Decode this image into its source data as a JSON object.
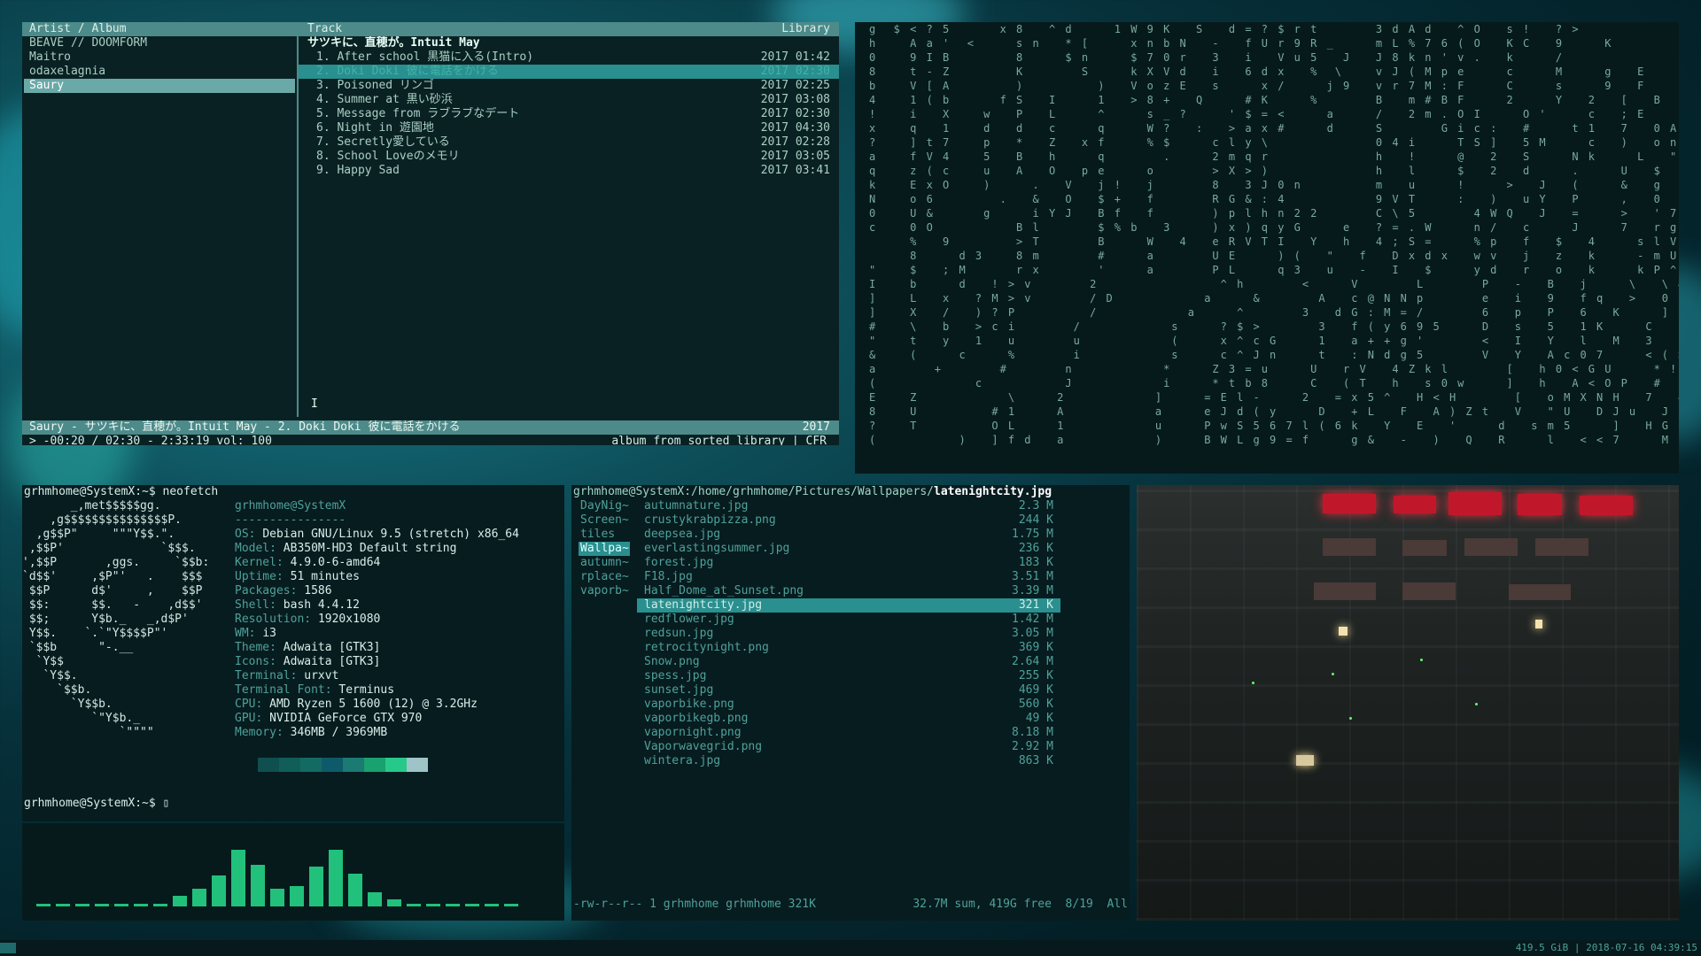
{
  "cmus": {
    "header": {
      "left": "Artist / Album",
      "mid": "Track",
      "right": "Library"
    },
    "artists": [
      "BEAVE // DOOMFORM",
      "Maitro",
      "odaxelagnia",
      "Saury"
    ],
    "selected_artist": "Saury",
    "album_title": "サツキに、直穂が。Intuit May",
    "tracks": [
      {
        "n": "1.",
        "title": "After school 黒猫に入る(Intro)",
        "time": "2017 01:42"
      },
      {
        "n": "2.",
        "title": "Doki Doki 彼に電話をかける",
        "time": "2017 02:30"
      },
      {
        "n": "3.",
        "title": "Poisoned リンゴ",
        "time": "2017 02:25"
      },
      {
        "n": "4.",
        "title": "Summer at 黒い砂浜",
        "time": "2017 03:08"
      },
      {
        "n": "5.",
        "title": "Message from ラブラブなデート",
        "time": "2017 02:30"
      },
      {
        "n": "6.",
        "title": "Night in 遊園地",
        "time": "2017 04:30"
      },
      {
        "n": "7.",
        "title": "Secretly愛している",
        "time": "2017 02:28"
      },
      {
        "n": "8.",
        "title": "School Loveのメモリ",
        "time": "2017 03:05"
      },
      {
        "n": "9.",
        "title": "Happy Sad",
        "time": "2017 03:41"
      }
    ],
    "current_index": 1,
    "status_line": "Saury - サツキに、直穂が。Intuit May -  2. Doki Doki 彼に電話をかける",
    "status_year": "2017",
    "progress_line": "> -00:20 / 02:30 - 2:33:19 vol: 100",
    "progress_mode": "album from sorted library | CFR",
    "cursor_glyph": "I"
  },
  "matrix": {
    "rows": [
      "g  $ < ? 5      x 8   ^ d     1 W 9 K   S   d = ? $ r t       3 d A d   ^ O   s !   ? >             4 Q",
      "h    A a '  <     s n   * [     x n b N   -   f U r 9 R _     m L % 7 6 ( O   K C   9     K           ] |",
      "0    9 I B        8     $ n     $ 7 0 r   3   i   V u 5   J   J 8 k n ' v .   k     /                 Q <",
      "8    t - Z        K       S     k X V d   i   6 d x   %  \\    v J ( M p e     c     M     g   E         =",
      "b    V [ A        )         )   V o z E   s     x /     j 9   v r 7 M : F     C     s     9   F         =",
      "4    1 ( b      f S   I     1   > 8 +   Q     # K     %       B   m # B F     2     Y   2   [   B       \\",
      "!    i   X    w   P   L     ^     s _ ?     ' $ = <     a     /   2 m . O I     O '     c   ; E         !",
      "x    q   1    d   d   c     q     W ?   :   > a x #     d     S       G i c :   #     t 1   7   0 A Z   d",
      "?    ] t 7    p   *   Z   x f     % $     c l y \\             0 4 i     T S ]   5 M     c   )   o n 4   d",
      "a    f V 4    5   B   h     q       .     2 m q r             h   !     @   2   S     N k     L   \"   f 2 x 6 b",
      "q    z ( c    u   A   O   p e     o       > X > )             h   l     $   2   d     .     U   $   9 : 9 1 0 f",
      "k    E x O    )     .   V   j !   j       8   3 J 0 n         m   u     !     >   J   (     &   g   . k l t 2 b",
      "N    o 6        .   &   O   $ +   f       R G & : 4           9 V T     :   )   u Y   P     ,   0   ! 8 S Y b 2",
      "0    U &      g     i Y J   B f   f       ) p l h n 2 2       C \\ 5       4 W Q   J   =     >   ' 7 % x s V A",
      "c    0 O          B l       $ % b   3     ) x ) q y G     e   ? = . W     n /   c     J     7   r g F w i   a",
      "     %   9        > T       B     W   4   e R V T I   Y   h   4 ; S =     % p   f   $   4     s l V \\ t",
      "     8     d 3    8 m       #     a       U E     ) (   \"   f   D x d x   w v   j   z   k     - m U b i",
      "\"    $   ; M      r x       '     a       P L     q 3   u   -   I   $     y d   r   o   k     k P ^ s a h",
      "I    b     d   ! > v       2               ^ h       <     V       L       P   -   B   j     \\   \\ & @ <",
      "]    L   x   ? M > v       / D           a     &       A   c @ N N p       e   i   9   f q   >   0 D k   @ R",
      "]    X   /   ) ? P         /           a     ^       3   d G : M = /       6   p   P   6   K     ]   F h h   \" Y",
      "#    \\   b   > c i       /           s     ? $ >       3   f ( y 6 9 5     D   s   5   1 K     C   D N 2   = R",
      "\"    t   y   1   u       u           (     x ^ c G     1   a + + g '       <   I   Y   l   M   3   ( ( L ? R",
      "&    (     c     %       i           s     c ^ J n     t   : N d g 5       V   Y   A c 0 7     < ( > ) 1 '   7",
      "a       +       #       n           *     Z 3 = u     U   r V   4 Z k l       [   h 0 < G U     * ! = I r = (",
      "(            c          J           i     * t b 8     C   ( T   h   s 0 w     ]   h   A < O P   #   ) ( / $ d 3",
      "E    Z           \\     2           ]     = E l -     2   = x 5 ^   H < H       [   o M X N H   7   # ) A # (",
      "8    U         # 1     A           a     e J d ( y     D   + L   F   A ) Z t   V   \" U   D J u   J   B I ( = a",
      "?    T         O L     1           u     P w S 5 6 7 l ( 6 k   Y   E   '     d   s m 5     ]   H G B _ ? ) +",
      "(          )   ] f d   a           )     B W L g 9 = f     g &   -   )   Q   R     l   < < 7     M   i & ' * n"
    ]
  },
  "neofetch": {
    "prompt_cmd": "grhmhome@SystemX:~$ neofetch",
    "prompt_end": "grhmhome@SystemX:~$ ",
    "cursor": "▯",
    "ascii": [
      "       _,met$$$$$gg.",
      "    ,g$$$$$$$$$$$$$$$P.",
      "  ,g$$P\"     \"\"\"Y$$.\".",
      " ,$$P'              `$$$.",
      "',$$P       ,ggs.     `$$b:",
      "`d$$'     ,$P\"'   .    $$$",
      " $$P      d$'     ,    $$P",
      " $$:      $$.   -    ,d$$'",
      " $$;      Y$b._   _,d$P'",
      " Y$$.    `.`\"Y$$$$P\"'",
      " `$$b      \"-.__",
      "  `Y$$",
      "   `Y$$.",
      "     `$$b.",
      "       `Y$$b.",
      "          `\"Y$b._",
      "              `\"\"\"\""
    ],
    "user_host": "grhmhome@SystemX",
    "separator": "----------------",
    "info": [
      {
        "k": "OS",
        "v": "Debian GNU/Linux 9.5 (stretch) x86_64"
      },
      {
        "k": "Model",
        "v": "AB350M-HD3 Default string"
      },
      {
        "k": "Kernel",
        "v": "4.9.0-6-amd64"
      },
      {
        "k": "Uptime",
        "v": "51 minutes"
      },
      {
        "k": "Packages",
        "v": "1586"
      },
      {
        "k": "Shell",
        "v": "bash 4.4.12"
      },
      {
        "k": "Resolution",
        "v": "1920x1080"
      },
      {
        "k": "WM",
        "v": "i3"
      },
      {
        "k": "Theme",
        "v": "Adwaita [GTK3]"
      },
      {
        "k": "Icons",
        "v": "Adwaita [GTK3]"
      },
      {
        "k": "Terminal",
        "v": "urxvt"
      },
      {
        "k": "Terminal Font",
        "v": "Terminus"
      },
      {
        "k": "CPU",
        "v": "AMD Ryzen 5 1600 (12) @ 3.2GHz"
      },
      {
        "k": "GPU",
        "v": "NVIDIA GeForce GTX 970"
      },
      {
        "k": "Memory",
        "v": "346MB / 3969MB"
      }
    ],
    "swatch_colors": [
      "#0f4f4f",
      "#115e58",
      "#136a63",
      "#0f5a6a",
      "#1b7a72",
      "#19a16f",
      "#27c98a",
      "#9ec4c8"
    ]
  },
  "visualizer": {
    "levels": [
      0,
      0,
      0,
      0,
      0,
      0,
      0,
      0.15,
      0.25,
      0.45,
      0.82,
      0.6,
      0.25,
      0.3,
      0.58,
      0.82,
      0.48,
      0.2,
      0.1,
      0,
      0,
      0,
      0,
      0,
      0
    ],
    "bar_color": "#21c17b"
  },
  "ranger": {
    "path_prefix": "grhmhome@SystemX:/home/grhmhome/Pictures/Wallpapers/",
    "path_file": "latenightcity.jpg",
    "dirs": [
      "DayNig~",
      "Screen~",
      "tiles",
      "Wallpa~",
      "autumn~",
      "rplace~",
      "vaporb~"
    ],
    "selected_dir": 3,
    "files": [
      {
        "name": "autumnature.jpg",
        "size": "2.3 M"
      },
      {
        "name": "crustykrabpizza.png",
        "size": "244 K"
      },
      {
        "name": "deepsea.jpg",
        "size": "1.75 M"
      },
      {
        "name": "everlastingsummer.jpg",
        "size": "236 K"
      },
      {
        "name": "forest.jpg",
        "size": "183 K"
      },
      {
        "name": "F18.jpg",
        "size": "3.51 M"
      },
      {
        "name": "Half_Dome_at_Sunset.png",
        "size": "3.39 M"
      },
      {
        "name": "latenightcity.jpg",
        "size": "321 K"
      },
      {
        "name": "redflower.jpg",
        "size": "1.42 M"
      },
      {
        "name": "redsun.jpg",
        "size": "3.05 M"
      },
      {
        "name": "retrocitynight.png",
        "size": "369 K"
      },
      {
        "name": "Snow.png",
        "size": "2.64 M"
      },
      {
        "name": "spess.jpg",
        "size": "255 K"
      },
      {
        "name": "sunset.jpg",
        "size": "469 K"
      },
      {
        "name": "vaporbike.png",
        "size": "560 K"
      },
      {
        "name": "vaporbikegb.png",
        "size": "49 K"
      },
      {
        "name": "vapornight.png",
        "size": "8.18 M"
      },
      {
        "name": "Vaporwavegrid.png",
        "size": "2.92 M"
      },
      {
        "name": "wintera.jpg",
        "size": "863 K"
      }
    ],
    "selected_file": 7,
    "status_left": "-rw-r--r-- 1 grhmhome grhmhome 321K",
    "status_right": "32.7M sum, 419G free  8/19  All"
  },
  "i3bar": {
    "status": "419.5 GiB | 2018-07-16 04:39:15"
  }
}
